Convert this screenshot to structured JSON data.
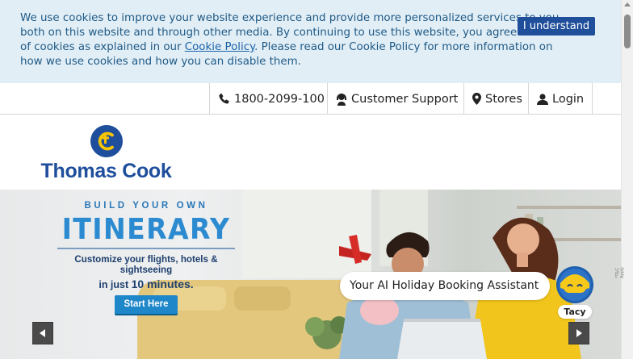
{
  "cookie_banner": {
    "text_before_link": "We use cookies to improve your website experience and provide more personalized services to you, both on this website and through other media. By continuing to use this website, you agree to our use of cookies as explained in our ",
    "link_text": "Cookie Policy",
    "text_after_link": ". Please read our Cookie Policy for more information on how we use cookies and how you can disable them.",
    "button_label": "I understand"
  },
  "top_nav": {
    "phone": "1800-2099-100",
    "support": "Customer Support",
    "stores": "Stores",
    "login": "Login"
  },
  "logo": {
    "brand": "Thomas Cook",
    "icon": "thomas-cook-globe-logo"
  },
  "hero": {
    "eyebrow": "BUILD YOUR OWN",
    "title": "ITINERARY",
    "subtitle": "Customize your flights, hotels & sightseeing",
    "subtitle2_prefix": "in just ",
    "subtitle2_bold": "10 minutes.",
    "cta": "Start Here",
    "tag": "*T&C Apply"
  },
  "assistant": {
    "prompt": "Your AI Holiday Booking Assistant",
    "name": "Tacy"
  },
  "carousel": {
    "prev_icon": "caret-left-icon",
    "next_icon": "caret-right-icon"
  },
  "colors": {
    "brand_blue": "#1e4e9c",
    "logo_yellow": "#f6c400",
    "cookie_bg": "#e2eef6",
    "button_blue": "#1f4e9a"
  }
}
